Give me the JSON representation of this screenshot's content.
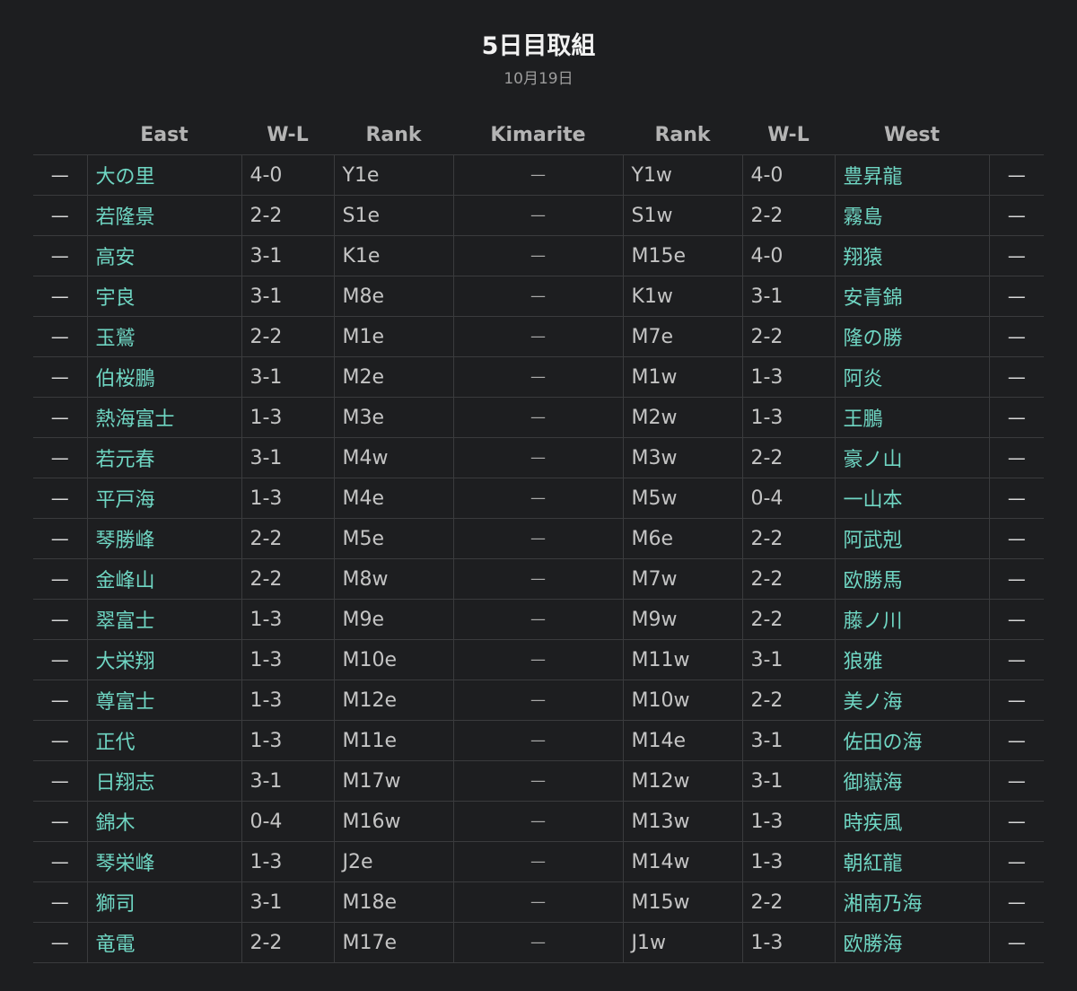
{
  "header": {
    "title": "5日目取組",
    "date": "10月19日"
  },
  "columns": {
    "east": "East",
    "wl_east": "W-L",
    "rank_east": "Rank",
    "kimarite": "Kimarite",
    "rank_west": "Rank",
    "wl_west": "W-L",
    "west": "West"
  },
  "rows": [
    {
      "east_result": "—",
      "east": "大の里",
      "east_wl": "4-0",
      "east_rank": "Y1e",
      "kimarite": "—",
      "west_rank": "Y1w",
      "west_wl": "4-0",
      "west": "豊昇龍",
      "west_result": "—"
    },
    {
      "east_result": "—",
      "east": "若隆景",
      "east_wl": "2-2",
      "east_rank": "S1e",
      "kimarite": "—",
      "west_rank": "S1w",
      "west_wl": "2-2",
      "west": "霧島",
      "west_result": "—"
    },
    {
      "east_result": "—",
      "east": "高安",
      "east_wl": "3-1",
      "east_rank": "K1e",
      "kimarite": "—",
      "west_rank": "M15e",
      "west_wl": "4-0",
      "west": "翔猿",
      "west_result": "—"
    },
    {
      "east_result": "—",
      "east": "宇良",
      "east_wl": "3-1",
      "east_rank": "M8e",
      "kimarite": "—",
      "west_rank": "K1w",
      "west_wl": "3-1",
      "west": "安青錦",
      "west_result": "—"
    },
    {
      "east_result": "—",
      "east": "玉鷲",
      "east_wl": "2-2",
      "east_rank": "M1e",
      "kimarite": "—",
      "west_rank": "M7e",
      "west_wl": "2-2",
      "west": "隆の勝",
      "west_result": "—"
    },
    {
      "east_result": "—",
      "east": "伯桜鵬",
      "east_wl": "3-1",
      "east_rank": "M2e",
      "kimarite": "—",
      "west_rank": "M1w",
      "west_wl": "1-3",
      "west": "阿炎",
      "west_result": "—"
    },
    {
      "east_result": "—",
      "east": "熱海富士",
      "east_wl": "1-3",
      "east_rank": "M3e",
      "kimarite": "—",
      "west_rank": "M2w",
      "west_wl": "1-3",
      "west": "王鵬",
      "west_result": "—"
    },
    {
      "east_result": "—",
      "east": "若元春",
      "east_wl": "3-1",
      "east_rank": "M4w",
      "kimarite": "—",
      "west_rank": "M3w",
      "west_wl": "2-2",
      "west": "豪ノ山",
      "west_result": "—"
    },
    {
      "east_result": "—",
      "east": "平戸海",
      "east_wl": "1-3",
      "east_rank": "M4e",
      "kimarite": "—",
      "west_rank": "M5w",
      "west_wl": "0-4",
      "west": "一山本",
      "west_result": "—"
    },
    {
      "east_result": "—",
      "east": "琴勝峰",
      "east_wl": "2-2",
      "east_rank": "M5e",
      "kimarite": "—",
      "west_rank": "M6e",
      "west_wl": "2-2",
      "west": "阿武剋",
      "west_result": "—"
    },
    {
      "east_result": "—",
      "east": "金峰山",
      "east_wl": "2-2",
      "east_rank": "M8w",
      "kimarite": "—",
      "west_rank": "M7w",
      "west_wl": "2-2",
      "west": "欧勝馬",
      "west_result": "—"
    },
    {
      "east_result": "—",
      "east": "翠富士",
      "east_wl": "1-3",
      "east_rank": "M9e",
      "kimarite": "—",
      "west_rank": "M9w",
      "west_wl": "2-2",
      "west": "藤ノ川",
      "west_result": "—"
    },
    {
      "east_result": "—",
      "east": "大栄翔",
      "east_wl": "1-3",
      "east_rank": "M10e",
      "kimarite": "—",
      "west_rank": "M11w",
      "west_wl": "3-1",
      "west": "狼雅",
      "west_result": "—"
    },
    {
      "east_result": "—",
      "east": "尊富士",
      "east_wl": "1-3",
      "east_rank": "M12e",
      "kimarite": "—",
      "west_rank": "M10w",
      "west_wl": "2-2",
      "west": "美ノ海",
      "west_result": "—"
    },
    {
      "east_result": "—",
      "east": "正代",
      "east_wl": "1-3",
      "east_rank": "M11e",
      "kimarite": "—",
      "west_rank": "M14e",
      "west_wl": "3-1",
      "west": "佐田の海",
      "west_result": "—"
    },
    {
      "east_result": "—",
      "east": "日翔志",
      "east_wl": "3-1",
      "east_rank": "M17w",
      "kimarite": "—",
      "west_rank": "M12w",
      "west_wl": "3-1",
      "west": "御嶽海",
      "west_result": "—"
    },
    {
      "east_result": "—",
      "east": "錦木",
      "east_wl": "0-4",
      "east_rank": "M16w",
      "kimarite": "—",
      "west_rank": "M13w",
      "west_wl": "1-3",
      "west": "時疾風",
      "west_result": "—"
    },
    {
      "east_result": "—",
      "east": "琴栄峰",
      "east_wl": "1-3",
      "east_rank": "J2e",
      "kimarite": "—",
      "west_rank": "M14w",
      "west_wl": "1-3",
      "west": "朝紅龍",
      "west_result": "—"
    },
    {
      "east_result": "—",
      "east": "獅司",
      "east_wl": "3-1",
      "east_rank": "M18e",
      "kimarite": "—",
      "west_rank": "M15w",
      "west_wl": "2-2",
      "west": "湘南乃海",
      "west_result": "—"
    },
    {
      "east_result": "—",
      "east": "竜電",
      "east_wl": "2-2",
      "east_rank": "M17e",
      "kimarite": "—",
      "west_rank": "J1w",
      "west_wl": "1-3",
      "west": "欧勝海",
      "west_result": "—"
    }
  ],
  "colors": {
    "background": "#1d1e20",
    "name_accent": "#6fd6c3",
    "grid_line": "#3a3b3d"
  }
}
